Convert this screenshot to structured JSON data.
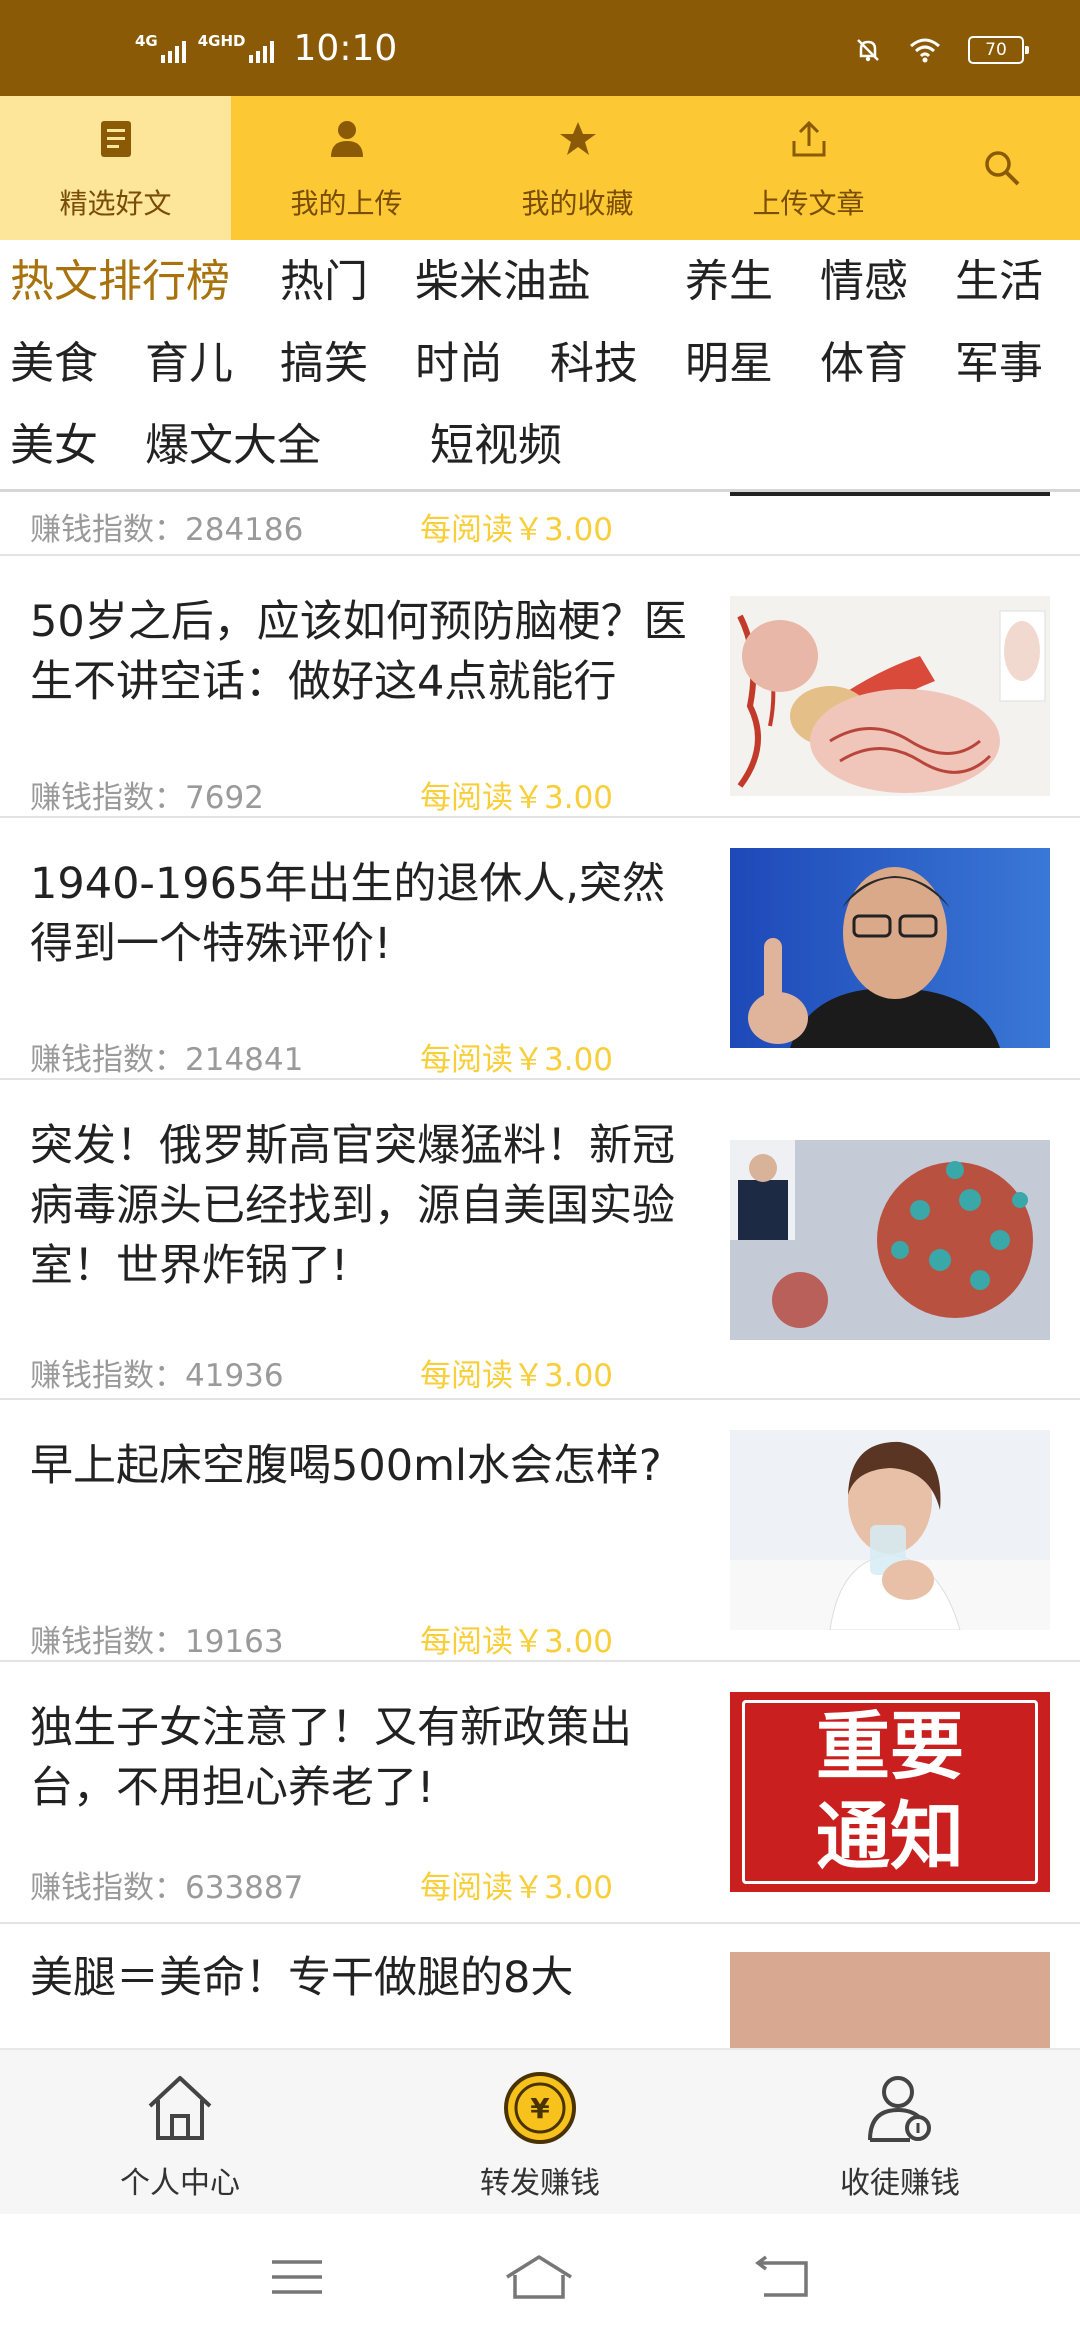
{
  "status_bar": {
    "net1": "4G",
    "net2": "4GHD",
    "time": "10:10",
    "battery": "70",
    "icons": [
      "mute-bell-icon",
      "wifi-icon",
      "battery-icon"
    ]
  },
  "top_tabs": [
    {
      "label": "精选好文",
      "icon": "document-icon",
      "active": true
    },
    {
      "label": "我的上传",
      "icon": "person-icon",
      "active": false
    },
    {
      "label": "我的收藏",
      "icon": "star-icon",
      "active": false
    },
    {
      "label": "上传文章",
      "icon": "upload-icon",
      "active": false
    }
  ],
  "search_icon": "search-icon",
  "categories": [
    "热文排行榜",
    "热门",
    "柴米油盐",
    "养生",
    "情感",
    "生活",
    "美食",
    "育儿",
    "搞笑",
    "时尚",
    "科技",
    "明星",
    "体育",
    "军事",
    "美女",
    "爆文大全",
    "短视频"
  ],
  "feed": {
    "earn_label": "赚钱指数：",
    "price_label": "每阅读￥3.00",
    "partial_top_value": "284186",
    "items": [
      {
        "title": "50岁之后，应该如何预防脑梗？医生不讲空话：做好这4点就能行",
        "value": "7692"
      },
      {
        "title": "1940-1965年出生的退休人,突然得到一个特殊评价!",
        "value": "214841"
      },
      {
        "title": "突发！俄罗斯高官突爆猛料！新冠病毒源头已经找到，源自美国实验室！世界炸锅了!",
        "value": "41936"
      },
      {
        "title": "早上起床空腹喝500ml水会怎样?",
        "value": "19163"
      },
      {
        "title": "独生子女注意了！又有新政策出台，不用担心养老了!",
        "value": "633887"
      }
    ],
    "partial_bottom_title": "美腿＝美命！专干做腿的8大",
    "notice_image_text": [
      "重要",
      "通知"
    ]
  },
  "bottom_nav": [
    {
      "label": "个人中心",
      "icon": "home-icon"
    },
    {
      "label": "转发赚钱",
      "icon": "coin-yen-icon"
    },
    {
      "label": "收徒赚钱",
      "icon": "recruit-user-icon"
    }
  ],
  "system_nav": [
    "menu-icon",
    "home-outline-icon",
    "back-icon"
  ]
}
